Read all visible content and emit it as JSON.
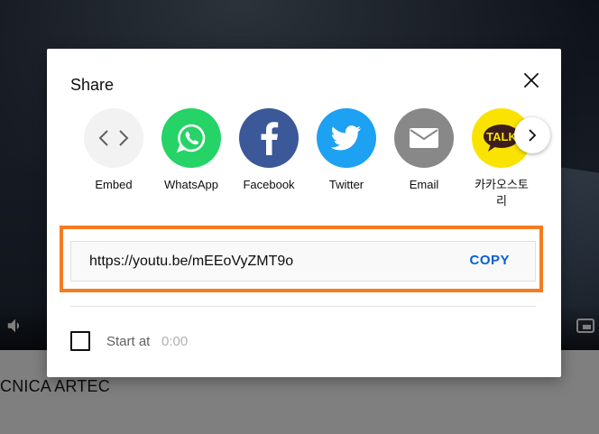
{
  "background": {
    "video_title": "CNICA ARTEC"
  },
  "dialog": {
    "title": "Share",
    "share_targets": [
      {
        "label": "Embed",
        "icon": "embed-icon",
        "color": "#f2f2f2"
      },
      {
        "label": "WhatsApp",
        "icon": "whatsapp-icon",
        "color": "#25d366"
      },
      {
        "label": "Facebook",
        "icon": "facebook-icon",
        "color": "#3b5998"
      },
      {
        "label": "Twitter",
        "icon": "twitter-icon",
        "color": "#1da1f2"
      },
      {
        "label": "Email",
        "icon": "email-icon",
        "color": "#888888"
      },
      {
        "label": "카카오스토리",
        "icon": "kakaotalk-icon",
        "color": "#fae300"
      }
    ],
    "kakao_badge": "TALK",
    "link": {
      "url": "https://youtu.be/mEEoVyZMT9o",
      "copy_label": "COPY"
    },
    "start_at": {
      "label": "Start at",
      "time": "0:00",
      "checked": false
    }
  },
  "colors": {
    "accent_blue": "#065fd4",
    "highlight_orange": "#f47c20"
  }
}
